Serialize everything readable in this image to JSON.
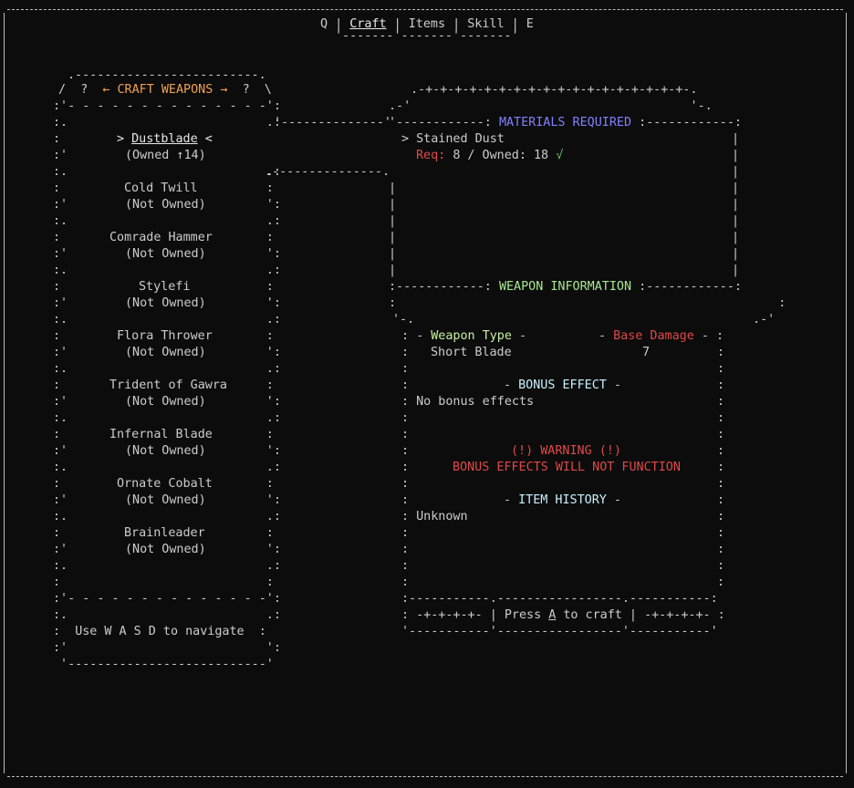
{
  "tabs": {
    "q": "Q",
    "craft": "Craft",
    "items": "Items",
    "skill": "Skill",
    "e": "E"
  },
  "left_panel": {
    "title": "CRAFT WEAPONS",
    "prev_arrow": "←",
    "next_arrow": "→",
    "q_mark": "?",
    "items": [
      {
        "name": "Dustblade",
        "status": "(Owned ↑14)",
        "selected": true
      },
      {
        "name": "Cold Twill",
        "status": "(Not Owned)"
      },
      {
        "name": "Comrade Hammer",
        "status": "(Not Owned)"
      },
      {
        "name": "Stylefi",
        "status": "(Not Owned)"
      },
      {
        "name": "Flora Thrower",
        "status": "(Not Owned)"
      },
      {
        "name": "Trident of Gawra",
        "status": "(Not Owned)"
      },
      {
        "name": "Infernal Blade",
        "status": "(Not Owned)"
      },
      {
        "name": "Ornate Cobalt",
        "status": "(Not Owned)"
      },
      {
        "name": "Brainleader",
        "status": "(Not Owned)"
      }
    ],
    "help": "Use W A S D to navigate"
  },
  "materials": {
    "heading": "MATERIALS REQUIRED",
    "item_name": "Stained Dust",
    "req_label": "Req:",
    "req_value": "8 / Owned: 18",
    "check": "√"
  },
  "weapon_info": {
    "heading": "WEAPON INFORMATION",
    "type_label": "Weapon Type",
    "type_value": "Short Blade",
    "damage_label": "Base Damage",
    "damage_value": "7",
    "bonus_heading": "BONUS EFFECT",
    "bonus_value": "No bonus effects",
    "warning_title": "(!) WARNING (!)",
    "warning_text": "BONUS EFFECTS WILL NOT FUNCTION",
    "history_heading": "ITEM HISTORY",
    "history_value": "Unknown",
    "craft_pre": "Press",
    "craft_key": "A",
    "craft_post": "to craft",
    "deco": "-+-+-+-+-"
  },
  "colors": {
    "background": "#0c0c0c",
    "text": "#cccccc",
    "title_orange": "#f0a050",
    "materials_blue": "#8080ff",
    "info_green": "#a8e890",
    "warning_red": "#e04848"
  }
}
